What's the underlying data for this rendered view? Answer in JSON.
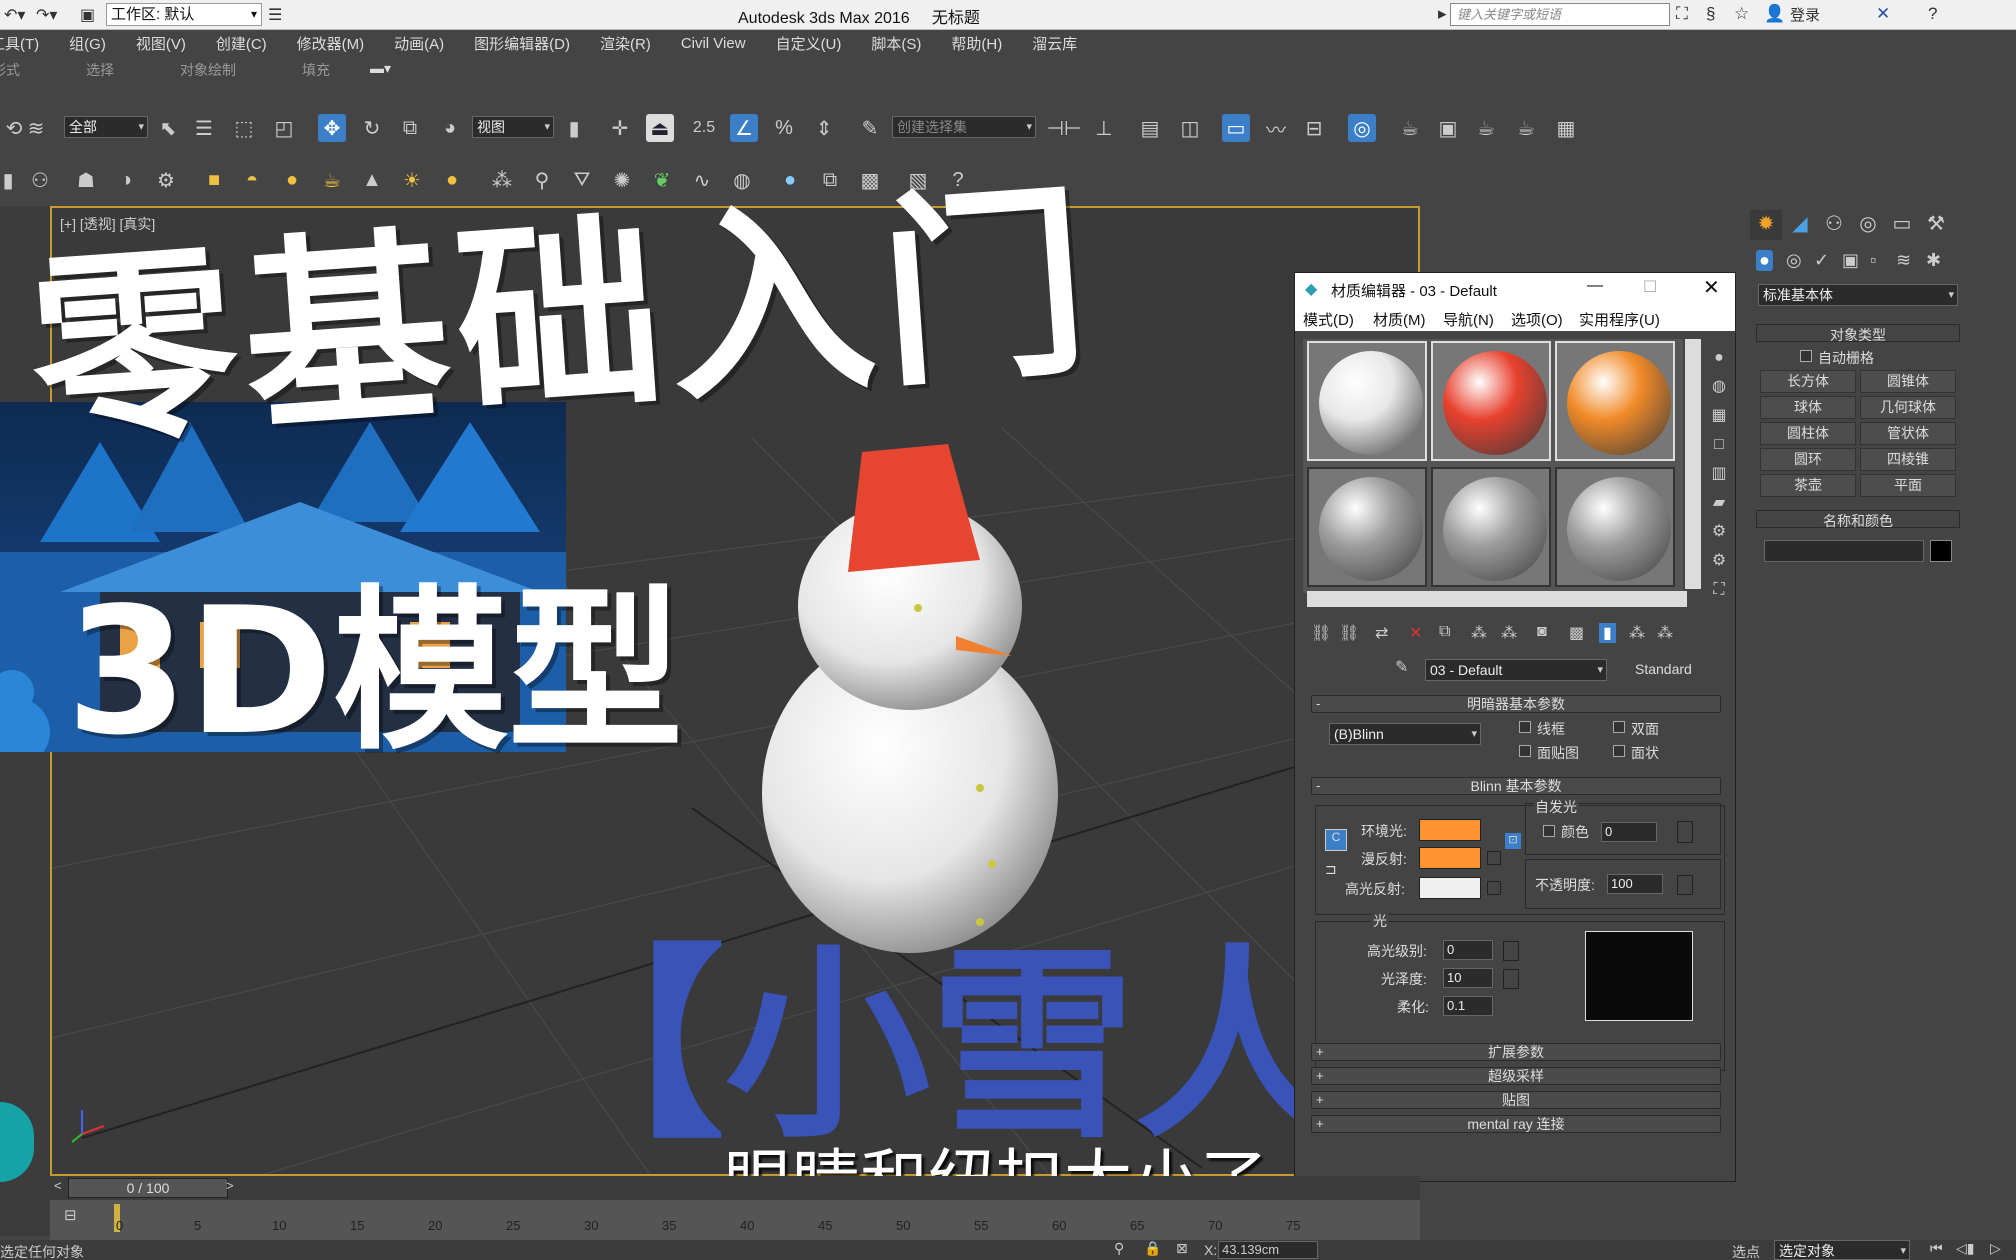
{
  "titlebar": {
    "workspace": "工作区: 默认",
    "app_title": "Autodesk 3ds Max 2016",
    "doc_title": "无标题",
    "search_placeholder": "键入关键字或短语",
    "login": "登录"
  },
  "menubar": {
    "items": [
      "工具(T)",
      "组(G)",
      "视图(V)",
      "创建(C)",
      "修改器(M)",
      "动画(A)",
      "图形编辑器(D)",
      "渲染(R)",
      "Civil View",
      "自定义(U)",
      "脚本(S)",
      "帮助(H)",
      "溜云库"
    ]
  },
  "ribbon": {
    "items": [
      "形式",
      "选择",
      "对象绘制",
      "填充"
    ]
  },
  "toolbar": {
    "filter": "全部",
    "refcoord": "视图",
    "named_sel": "创建选择集",
    "snap_value": "2.5"
  },
  "viewport": {
    "label": "[+] [透视] [真实]"
  },
  "overlay": {
    "headline": "零基础入门",
    "subhead": "3D模型",
    "project": "【小雪人】",
    "subtitle": "眼睛和纽扣太小了"
  },
  "material_editor": {
    "title": "材质编辑器 - 03 - Default",
    "menu": [
      "模式(D)",
      "材质(M)",
      "导航(N)",
      "选项(O)",
      "实用程序(U)"
    ],
    "material_name": "03 - Default",
    "material_type": "Standard",
    "shader_rollout": "明暗器基本参数",
    "shader": "(B)Blinn",
    "wire": "线框",
    "two_sided": "双面",
    "face_map": "面贴图",
    "faceted": "面状",
    "blinn_rollout": "Blinn 基本参数",
    "self_illum": "自发光",
    "color_label": "颜色",
    "self_illum_value": "0",
    "ambient": "环境光:",
    "diffuse": "漫反射:",
    "specular": "高光反射:",
    "opacity_label": "不透明度:",
    "opacity_value": "100",
    "highlight_group": "光",
    "spec_level": "高光级别:",
    "spec_level_value": "0",
    "glossiness": "光泽度:",
    "glossiness_value": "10",
    "soften": "柔化:",
    "soften_value": "0.1",
    "rollouts": [
      "扩展参数",
      "超级采样",
      "贴图",
      "mental ray 连接"
    ],
    "colors": {
      "ambient": "#ff9433",
      "diffuse": "#ff9433",
      "specular": "#f0f0f0"
    },
    "slot_colors": [
      "#e8e8e8",
      "#e8412e",
      "#f18a28",
      "#9e9e9e",
      "#9e9e9e",
      "#9e9e9e"
    ]
  },
  "command_panel": {
    "category": "标准基本体",
    "object_type_rollout": "对象类型",
    "autogrid": "自动栅格",
    "objects": [
      "长方体",
      "圆锥体",
      "球体",
      "几何球体",
      "圆柱体",
      "管状体",
      "圆环",
      "四棱锥",
      "茶壶",
      "平面"
    ],
    "name_color_rollout": "名称和颜色"
  },
  "timeline": {
    "frame": "0 / 100",
    "ticks": [
      "0",
      "5",
      "10",
      "15",
      "20",
      "25",
      "30",
      "35",
      "40",
      "45",
      "50",
      "55",
      "60",
      "65",
      "70",
      "75"
    ]
  },
  "status": {
    "prompt": "选定任何对象",
    "x_label": "X:",
    "x_value": "43.139cm",
    "mode_label": "选点",
    "mode": "选定对象"
  },
  "scene": {
    "hat_color": "#e64530",
    "nose_color": "#f08030",
    "snow_color": "#f2f2f2"
  }
}
